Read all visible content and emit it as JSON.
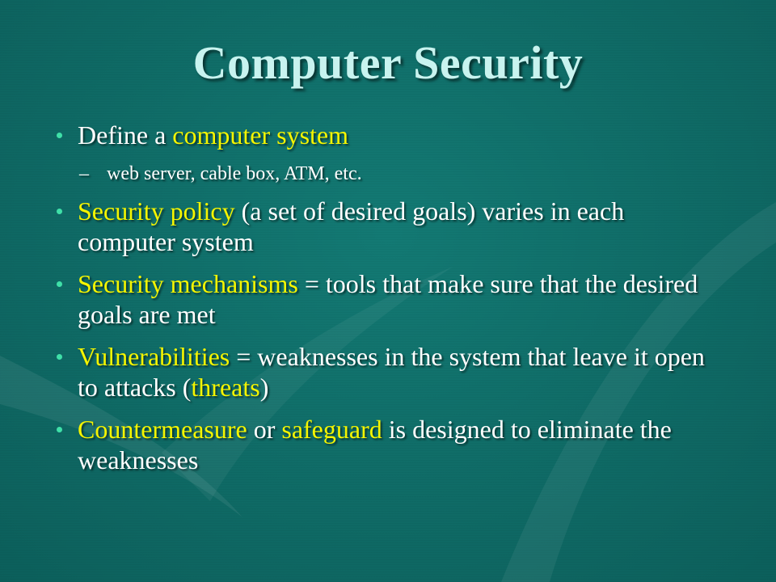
{
  "slide": {
    "title": "Computer Security",
    "colors": {
      "background": "#0f6b66",
      "title": "#c8f3ef",
      "text": "#ffffff",
      "highlight": "#f5f500",
      "bullet": "#3fe0a8"
    },
    "bullets": [
      {
        "parts": [
          {
            "text": "Define a ",
            "highlight": false
          },
          {
            "text": "computer system",
            "highlight": true
          }
        ],
        "sub": {
          "dash": "–",
          "text": "web server, cable box, ATM, etc."
        }
      },
      {
        "parts": [
          {
            "text": "Security policy",
            "highlight": true
          },
          {
            "text": " (a set of desired goals) varies in each computer system",
            "highlight": false
          }
        ]
      },
      {
        "parts": [
          {
            "text": "Security mechanisms",
            "highlight": true
          },
          {
            "text": " = tools that make sure that the desired goals are met",
            "highlight": false
          }
        ]
      },
      {
        "parts": [
          {
            "text": "Vulnerabilities",
            "highlight": true
          },
          {
            "text": " = weaknesses in the system that leave it open to attacks (",
            "highlight": false
          },
          {
            "text": "threats",
            "highlight": true
          },
          {
            "text": ")",
            "highlight": false
          }
        ]
      },
      {
        "parts": [
          {
            "text": "Countermeasure",
            "highlight": true
          },
          {
            "text": " or ",
            "highlight": false
          },
          {
            "text": "safeguard",
            "highlight": true
          },
          {
            "text": " is designed to eliminate the weaknesses",
            "highlight": false
          }
        ]
      }
    ]
  }
}
